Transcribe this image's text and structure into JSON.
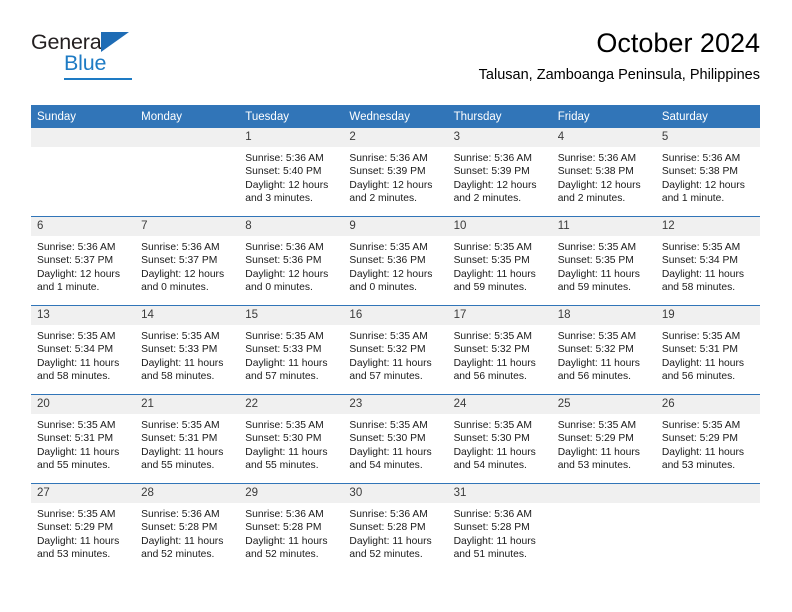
{
  "brand": {
    "name_top": "General",
    "name_bottom": "Blue",
    "accent_color": "#1e7bc4"
  },
  "header": {
    "month_year": "October 2024",
    "location": "Talusan, Zamboanga Peninsula, Philippines"
  },
  "theme": {
    "header_blue": "#3175b8",
    "daynum_bg": "#f0f0f0",
    "cell_bg": "#ffffff"
  },
  "weekday_headers": [
    "Sunday",
    "Monday",
    "Tuesday",
    "Wednesday",
    "Thursday",
    "Friday",
    "Saturday"
  ],
  "weeks": [
    [
      {
        "day": "",
        "sunrise": "",
        "sunset": "",
        "daylight_1": "",
        "daylight_2": ""
      },
      {
        "day": "",
        "sunrise": "",
        "sunset": "",
        "daylight_1": "",
        "daylight_2": ""
      },
      {
        "day": "1",
        "sunrise": "Sunrise: 5:36 AM",
        "sunset": "Sunset: 5:40 PM",
        "daylight_1": "Daylight: 12 hours",
        "daylight_2": "and 3 minutes."
      },
      {
        "day": "2",
        "sunrise": "Sunrise: 5:36 AM",
        "sunset": "Sunset: 5:39 PM",
        "daylight_1": "Daylight: 12 hours",
        "daylight_2": "and 2 minutes."
      },
      {
        "day": "3",
        "sunrise": "Sunrise: 5:36 AM",
        "sunset": "Sunset: 5:39 PM",
        "daylight_1": "Daylight: 12 hours",
        "daylight_2": "and 2 minutes."
      },
      {
        "day": "4",
        "sunrise": "Sunrise: 5:36 AM",
        "sunset": "Sunset: 5:38 PM",
        "daylight_1": "Daylight: 12 hours",
        "daylight_2": "and 2 minutes."
      },
      {
        "day": "5",
        "sunrise": "Sunrise: 5:36 AM",
        "sunset": "Sunset: 5:38 PM",
        "daylight_1": "Daylight: 12 hours",
        "daylight_2": "and 1 minute."
      }
    ],
    [
      {
        "day": "6",
        "sunrise": "Sunrise: 5:36 AM",
        "sunset": "Sunset: 5:37 PM",
        "daylight_1": "Daylight: 12 hours",
        "daylight_2": "and 1 minute."
      },
      {
        "day": "7",
        "sunrise": "Sunrise: 5:36 AM",
        "sunset": "Sunset: 5:37 PM",
        "daylight_1": "Daylight: 12 hours",
        "daylight_2": "and 0 minutes."
      },
      {
        "day": "8",
        "sunrise": "Sunrise: 5:36 AM",
        "sunset": "Sunset: 5:36 PM",
        "daylight_1": "Daylight: 12 hours",
        "daylight_2": "and 0 minutes."
      },
      {
        "day": "9",
        "sunrise": "Sunrise: 5:35 AM",
        "sunset": "Sunset: 5:36 PM",
        "daylight_1": "Daylight: 12 hours",
        "daylight_2": "and 0 minutes."
      },
      {
        "day": "10",
        "sunrise": "Sunrise: 5:35 AM",
        "sunset": "Sunset: 5:35 PM",
        "daylight_1": "Daylight: 11 hours",
        "daylight_2": "and 59 minutes."
      },
      {
        "day": "11",
        "sunrise": "Sunrise: 5:35 AM",
        "sunset": "Sunset: 5:35 PM",
        "daylight_1": "Daylight: 11 hours",
        "daylight_2": "and 59 minutes."
      },
      {
        "day": "12",
        "sunrise": "Sunrise: 5:35 AM",
        "sunset": "Sunset: 5:34 PM",
        "daylight_1": "Daylight: 11 hours",
        "daylight_2": "and 58 minutes."
      }
    ],
    [
      {
        "day": "13",
        "sunrise": "Sunrise: 5:35 AM",
        "sunset": "Sunset: 5:34 PM",
        "daylight_1": "Daylight: 11 hours",
        "daylight_2": "and 58 minutes."
      },
      {
        "day": "14",
        "sunrise": "Sunrise: 5:35 AM",
        "sunset": "Sunset: 5:33 PM",
        "daylight_1": "Daylight: 11 hours",
        "daylight_2": "and 58 minutes."
      },
      {
        "day": "15",
        "sunrise": "Sunrise: 5:35 AM",
        "sunset": "Sunset: 5:33 PM",
        "daylight_1": "Daylight: 11 hours",
        "daylight_2": "and 57 minutes."
      },
      {
        "day": "16",
        "sunrise": "Sunrise: 5:35 AM",
        "sunset": "Sunset: 5:32 PM",
        "daylight_1": "Daylight: 11 hours",
        "daylight_2": "and 57 minutes."
      },
      {
        "day": "17",
        "sunrise": "Sunrise: 5:35 AM",
        "sunset": "Sunset: 5:32 PM",
        "daylight_1": "Daylight: 11 hours",
        "daylight_2": "and 56 minutes."
      },
      {
        "day": "18",
        "sunrise": "Sunrise: 5:35 AM",
        "sunset": "Sunset: 5:32 PM",
        "daylight_1": "Daylight: 11 hours",
        "daylight_2": "and 56 minutes."
      },
      {
        "day": "19",
        "sunrise": "Sunrise: 5:35 AM",
        "sunset": "Sunset: 5:31 PM",
        "daylight_1": "Daylight: 11 hours",
        "daylight_2": "and 56 minutes."
      }
    ],
    [
      {
        "day": "20",
        "sunrise": "Sunrise: 5:35 AM",
        "sunset": "Sunset: 5:31 PM",
        "daylight_1": "Daylight: 11 hours",
        "daylight_2": "and 55 minutes."
      },
      {
        "day": "21",
        "sunrise": "Sunrise: 5:35 AM",
        "sunset": "Sunset: 5:31 PM",
        "daylight_1": "Daylight: 11 hours",
        "daylight_2": "and 55 minutes."
      },
      {
        "day": "22",
        "sunrise": "Sunrise: 5:35 AM",
        "sunset": "Sunset: 5:30 PM",
        "daylight_1": "Daylight: 11 hours",
        "daylight_2": "and 55 minutes."
      },
      {
        "day": "23",
        "sunrise": "Sunrise: 5:35 AM",
        "sunset": "Sunset: 5:30 PM",
        "daylight_1": "Daylight: 11 hours",
        "daylight_2": "and 54 minutes."
      },
      {
        "day": "24",
        "sunrise": "Sunrise: 5:35 AM",
        "sunset": "Sunset: 5:30 PM",
        "daylight_1": "Daylight: 11 hours",
        "daylight_2": "and 54 minutes."
      },
      {
        "day": "25",
        "sunrise": "Sunrise: 5:35 AM",
        "sunset": "Sunset: 5:29 PM",
        "daylight_1": "Daylight: 11 hours",
        "daylight_2": "and 53 minutes."
      },
      {
        "day": "26",
        "sunrise": "Sunrise: 5:35 AM",
        "sunset": "Sunset: 5:29 PM",
        "daylight_1": "Daylight: 11 hours",
        "daylight_2": "and 53 minutes."
      }
    ],
    [
      {
        "day": "27",
        "sunrise": "Sunrise: 5:35 AM",
        "sunset": "Sunset: 5:29 PM",
        "daylight_1": "Daylight: 11 hours",
        "daylight_2": "and 53 minutes."
      },
      {
        "day": "28",
        "sunrise": "Sunrise: 5:36 AM",
        "sunset": "Sunset: 5:28 PM",
        "daylight_1": "Daylight: 11 hours",
        "daylight_2": "and 52 minutes."
      },
      {
        "day": "29",
        "sunrise": "Sunrise: 5:36 AM",
        "sunset": "Sunset: 5:28 PM",
        "daylight_1": "Daylight: 11 hours",
        "daylight_2": "and 52 minutes."
      },
      {
        "day": "30",
        "sunrise": "Sunrise: 5:36 AM",
        "sunset": "Sunset: 5:28 PM",
        "daylight_1": "Daylight: 11 hours",
        "daylight_2": "and 52 minutes."
      },
      {
        "day": "31",
        "sunrise": "Sunrise: 5:36 AM",
        "sunset": "Sunset: 5:28 PM",
        "daylight_1": "Daylight: 11 hours",
        "daylight_2": "and 51 minutes."
      },
      {
        "day": "",
        "sunrise": "",
        "sunset": "",
        "daylight_1": "",
        "daylight_2": ""
      },
      {
        "day": "",
        "sunrise": "",
        "sunset": "",
        "daylight_1": "",
        "daylight_2": ""
      }
    ]
  ]
}
